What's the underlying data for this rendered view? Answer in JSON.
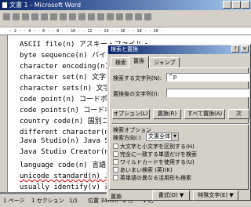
{
  "window": {
    "title": "文書 1 - Microsoft Word"
  },
  "ruler": {
    "text": "· 2 · · 4 · · 6 · · 8 · · 10 · · 12 · · 14 · · 16 · · 18 · · 20 ·"
  },
  "document": {
    "lines": [
      "ASCII file(n) アスキー・ファイル・",
      "byte sequence(n) バイト列",
      "character encoding(n) 文字符",
      "character set(n) 文字セット",
      "character sets(n) 文字セット",
      "code point(n) コードポイント",
      "code points(n) コードポイン",
      "country code(n) 国別コード",
      "different character(n) 異なる",
      "Java Studio(n) Java Studio",
      "Java Studio Creator(n) Java",
      "language code(n) 言語コード",
      "unicode standard(n) ユニコ",
      "usually identify(v) 通常, 識別"
    ]
  },
  "status_bar": {
    "page": "1 ページ",
    "section": "1 セクション",
    "page_of": "1/1",
    "position": "位置 34mm",
    "line": "1 行",
    "column": "1 桁"
  },
  "dialog": {
    "title": "検索と置換",
    "help_label": "?",
    "close_label": "×",
    "tabs": [
      "検索",
      "置換",
      "ジャンプ"
    ],
    "active_tab": "置換",
    "find_label": "検索する文字列(N):",
    "find_value": "^p",
    "replace_label": "置換後の文字列(I):",
    "replace_value": "",
    "buttons": {
      "options": "オプション(L) ≪",
      "replace": "置換(R)",
      "replace_all": "すべて置換(A)",
      "find_next": "次"
    },
    "search_options": {
      "heading": "検索オプション",
      "direction_label": "検索方向(:)",
      "direction_value": "文書全体",
      "checkboxes": [
        "大文字と小文字を区別する(H)",
        "完全に一致する単語だけを検索",
        "ワイルドカードを使用する(U)",
        "あいまい検索 (英)(K)",
        "英単語の異なる活用形も検索"
      ]
    },
    "bottom": {
      "section_label": "置換",
      "format_button": "書式(O) ▼",
      "special_button": "特殊文字(E) ▼"
    }
  }
}
